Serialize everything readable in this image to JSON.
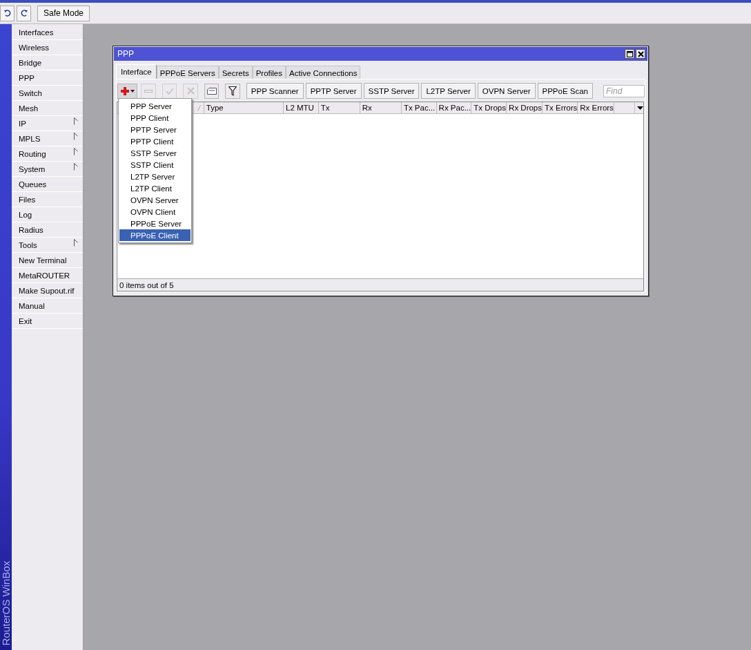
{
  "toolbar": {
    "safe_mode": {
      "label": "Safe Mode"
    }
  },
  "sidebar": {
    "brand": "RouterOS WinBox",
    "items": [
      {
        "label": "Interfaces",
        "has_submenu": false
      },
      {
        "label": "Wireless",
        "has_submenu": false
      },
      {
        "label": "Bridge",
        "has_submenu": false
      },
      {
        "label": "PPP",
        "has_submenu": false
      },
      {
        "label": "Switch",
        "has_submenu": false
      },
      {
        "label": "Mesh",
        "has_submenu": false
      },
      {
        "label": "IP",
        "has_submenu": true
      },
      {
        "label": "MPLS",
        "has_submenu": true
      },
      {
        "label": "Routing",
        "has_submenu": true
      },
      {
        "label": "System",
        "has_submenu": true
      },
      {
        "label": "Queues",
        "has_submenu": false
      },
      {
        "label": "Files",
        "has_submenu": false
      },
      {
        "label": "Log",
        "has_submenu": false
      },
      {
        "label": "Radius",
        "has_submenu": false
      },
      {
        "label": "Tools",
        "has_submenu": true
      },
      {
        "label": "New Terminal",
        "has_submenu": false
      },
      {
        "label": "MetaROUTER",
        "has_submenu": false
      },
      {
        "label": "Make Supout.rif",
        "has_submenu": false
      },
      {
        "label": "Manual",
        "has_submenu": false
      },
      {
        "label": "Exit",
        "has_submenu": false
      }
    ]
  },
  "window": {
    "title": "PPP",
    "tabs": [
      {
        "label": "Interface",
        "selected": true
      },
      {
        "label": "PPPoE Servers",
        "selected": false
      },
      {
        "label": "Secrets",
        "selected": false
      },
      {
        "label": "Profiles",
        "selected": false
      },
      {
        "label": "Active Connections",
        "selected": false
      }
    ],
    "icon_buttons": [
      {
        "kind": "add",
        "disabled": false
      },
      {
        "kind": "remove",
        "disabled": true
      },
      {
        "kind": "enable",
        "disabled": true
      },
      {
        "kind": "disable",
        "disabled": true
      },
      {
        "kind": "comment",
        "disabled": false
      },
      {
        "kind": "filter",
        "disabled": false
      }
    ],
    "buttons": [
      "PPP Scanner",
      "PPTP Server",
      "SSTP Server",
      "L2TP Server",
      "OVPN Server",
      "PPPoE Scan"
    ],
    "search": {
      "placeholder": "Find"
    },
    "table": {
      "columns": [
        "Type",
        "L2 MTU",
        "Tx",
        "Rx",
        "Tx Pac...",
        "Rx Pac...",
        "Tx Drops",
        "Rx Drops",
        "Tx Errors",
        "Rx Errors"
      ]
    },
    "add_menu": [
      {
        "label": "PPP Server",
        "selected": false
      },
      {
        "label": "PPP Client",
        "selected": false
      },
      {
        "label": "PPTP Server",
        "selected": false
      },
      {
        "label": "PPTP Client",
        "selected": false
      },
      {
        "label": "SSTP Server",
        "selected": false
      },
      {
        "label": "SSTP Client",
        "selected": false
      },
      {
        "label": "L2TP Server",
        "selected": false
      },
      {
        "label": "L2TP Client",
        "selected": false
      },
      {
        "label": "OVPN Server",
        "selected": false
      },
      {
        "label": "OVPN Client",
        "selected": false
      },
      {
        "label": "PPPoE Server",
        "selected": false
      },
      {
        "label": "PPPoE Client",
        "selected": true
      }
    ],
    "status_bar": "0 items out of 5"
  }
}
